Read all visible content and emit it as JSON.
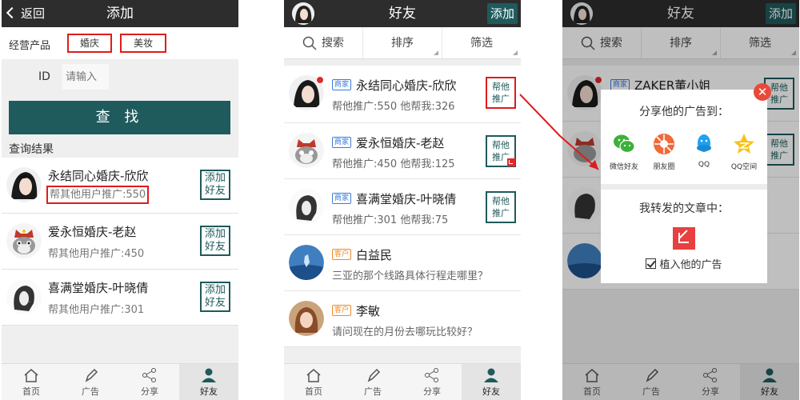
{
  "screen1": {
    "back_label": "返回",
    "title": "添加",
    "product_label": "经营产品",
    "tags": [
      "婚庆",
      "美妆"
    ],
    "id_label": "ID",
    "id_placeholder": "请输入",
    "find_button": "查 找",
    "results_label": "查询结果",
    "items": [
      {
        "name": "永结同心婚庆-欣欣",
        "sub": "帮其他用户推广:550",
        "action": "添加 好友"
      },
      {
        "name": "爱永恒婚庆-老赵",
        "sub": "帮其他用户推广:450",
        "action": "添加 好友"
      },
      {
        "name": "喜满堂婚庆-叶晓倩",
        "sub": "帮其他用户推广:301",
        "action": "添加 好友"
      }
    ]
  },
  "screen2": {
    "title": "好友",
    "add_button": "添加",
    "filters": {
      "search": "搜索",
      "sort": "排序",
      "filter": "筛选"
    },
    "items": [
      {
        "badge": "商家",
        "name": "永结同心婚庆-欣欣",
        "sub": "帮他推广:550   他帮我:326",
        "action": "帮他 推广"
      },
      {
        "badge": "商家",
        "name": "爱永恒婚庆-老赵",
        "sub": "帮他推广:450   他帮我:125",
        "action": "帮他 推广"
      },
      {
        "badge": "商家",
        "name": "喜满堂婚庆-叶晓倩",
        "sub": "帮他推广:301   他帮我:75",
        "action": "帮他 推广"
      },
      {
        "badge": "客户",
        "name": "白益民",
        "sub": "三亚的那个线路具体行程走哪里？"
      },
      {
        "badge": "客户",
        "name": "李敏",
        "sub": "请问现在的月份去哪玩比较好？"
      }
    ]
  },
  "screen3": {
    "title": "好友",
    "add_button": "添加",
    "filters": {
      "search": "搜索",
      "sort": "排序",
      "filter": "筛选"
    },
    "bg_items": [
      {
        "badge": "商家",
        "name": "ZAKER董小姐",
        "action": "帮他 推广"
      },
      {
        "action": "帮他 推广"
      }
    ],
    "dialog": {
      "share_title": "分享他的广告到：",
      "targets": [
        "微信好友",
        "朋友圈",
        "QQ",
        "QQ空间"
      ],
      "forward_title": "我转发的文章中：",
      "checkbox_label": "植入他的广告"
    },
    "close_glyph": "✕"
  },
  "bottom_nav": [
    "首页",
    "广告",
    "分享",
    "好友"
  ],
  "colors": {
    "accent": "#1f5a5c",
    "highlight": "#e01b1b",
    "titlebar": "#2d2d2d",
    "merchant_badge": "#3b7ad9",
    "customer_badge": "#f08a24"
  }
}
